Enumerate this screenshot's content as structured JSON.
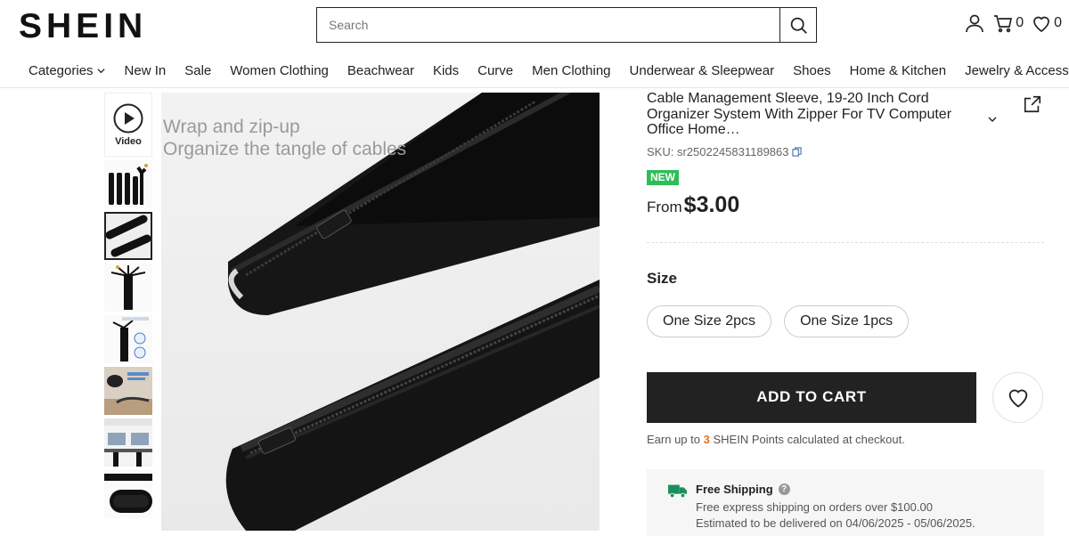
{
  "header": {
    "logo": "SHEIN",
    "search_placeholder": "Search",
    "cart_count": "0",
    "wishlist_count": "0"
  },
  "nav": [
    "Categories",
    "New In",
    "Sale",
    "Women Clothing",
    "Beachwear",
    "Kids",
    "Curve",
    "Men Clothing",
    "Underwear & Sleepwear",
    "Shoes",
    "Home & Kitchen",
    "Jewelry & Accessories"
  ],
  "gallery": {
    "video_label": "Video",
    "caption_line1": "Wrap and zip-up",
    "caption_line2": "Organize the tangle of cables"
  },
  "product": {
    "title": "Cable Management Sleeve, 19-20 Inch Cord Organizer System With Zipper For TV Computer Office Home…",
    "sku": "SKU: sr2502245831189863",
    "badge": "NEW",
    "price_prefix": "From",
    "price": "$3.00",
    "size_label": "Size",
    "sizes": [
      "One Size 2pcs",
      "One Size 1pcs"
    ],
    "add_to_cart": "ADD TO CART",
    "points_before": "Earn up to",
    "points_value": "3",
    "points_after": "SHEIN Points calculated at checkout."
  },
  "shipping": {
    "title": "Free Shipping",
    "line1": "Free express shipping on orders over $100.00",
    "line2": "Estimated to be delivered on 04/06/2025 - 05/06/2025."
  },
  "colors": {
    "badge_green": "#2ebd59",
    "points_orange": "#e8721c",
    "button_dark": "#222222",
    "shipping_truck": "#1a8f5c"
  }
}
